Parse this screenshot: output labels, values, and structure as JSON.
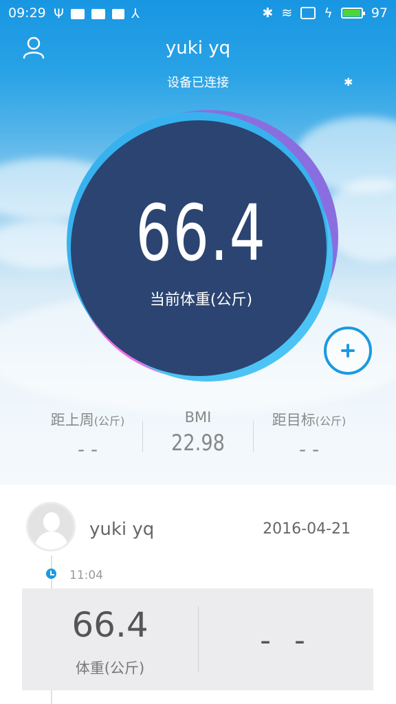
{
  "status_bar": {
    "time": "09:29",
    "battery": "97",
    "battery_level": 0.97
  },
  "header": {
    "title": "yuki yq",
    "connection_status": "设备已连接"
  },
  "main": {
    "current_weight": "66.4",
    "weight_label": "当前体重(公斤)"
  },
  "stats": {
    "last_week": {
      "label": "距上周",
      "unit": "(公斤)",
      "value": "- -"
    },
    "bmi": {
      "label": "BMI",
      "value": "22.98"
    },
    "target": {
      "label": "距目标",
      "unit": "(公斤)",
      "value": "- -"
    }
  },
  "record": {
    "name": "yuki yq",
    "date": "2016-04-21",
    "time": "11:04",
    "weight": "66.4",
    "weight_label": "体重(公斤)",
    "secondary_value": "- -"
  },
  "colors": {
    "accent": "#1a9ae0",
    "circle": "#2c4471",
    "battery": "#4cd43a"
  }
}
